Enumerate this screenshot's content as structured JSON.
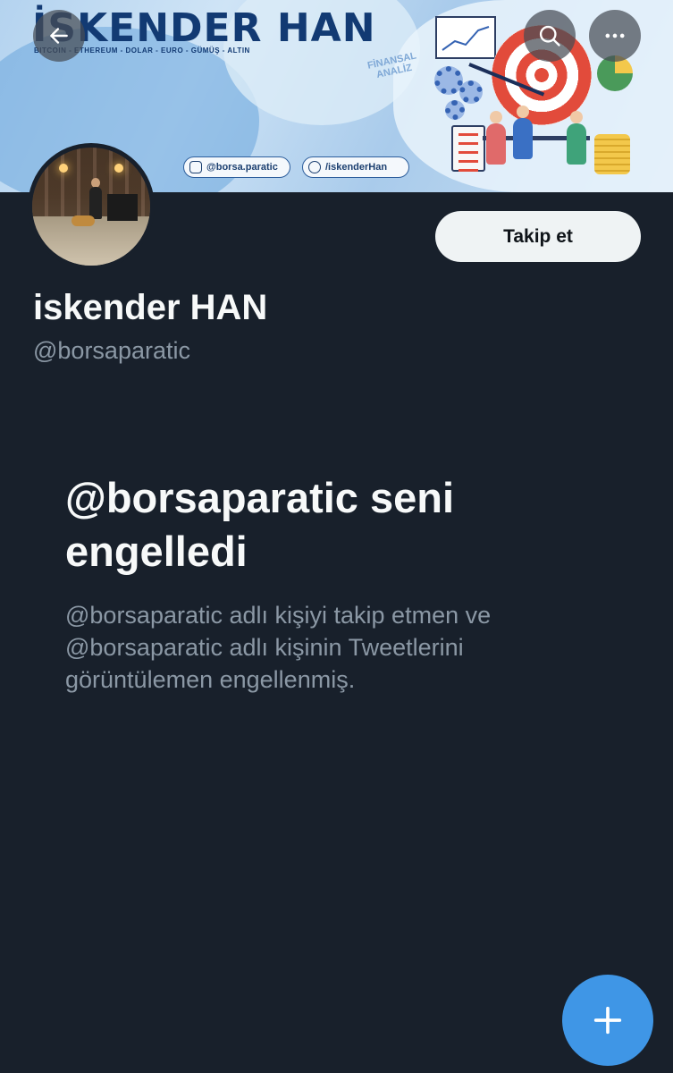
{
  "banner": {
    "brand_title": "İSKENDER HAN",
    "brand_subtitle": "BITCOIN - ETHEREUM - DOLAR - EURO - GÜMÜŞ - ALTIN",
    "finans_label_line1": "FİNANSAL",
    "finans_label_line2": "ANALİZ",
    "instagram_handle": "@borsa.paratic",
    "telegram_handle": "/iskenderHan"
  },
  "toolbar": {
    "back_icon": "arrow-left-icon",
    "search_icon": "search-icon",
    "more_icon": "more-horizontal-icon"
  },
  "profile": {
    "display_name": "iskender HAN",
    "handle": "@borsaparatic",
    "follow_label": "Takip et"
  },
  "blocked": {
    "title": "@borsaparatic seni engelledi",
    "description": "@borsaparatic adlı kişiyi takip etmen ve @borsaparatic adlı kişinin Tweetlerini görüntülemen engellenmiş."
  },
  "fab": {
    "icon": "plus-icon"
  },
  "colors": {
    "background": "#18202b",
    "accent": "#3f96e6",
    "secondary_text": "#8b98a5"
  }
}
